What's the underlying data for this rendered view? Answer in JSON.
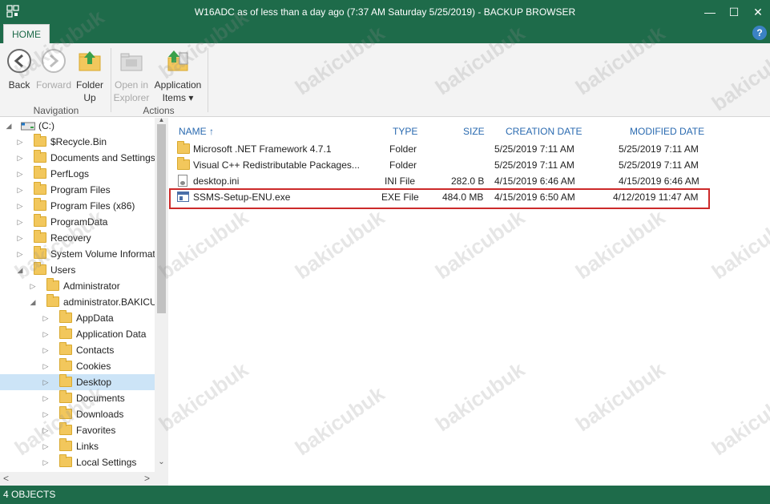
{
  "window": {
    "title": "W16ADC as of less than a day ago (7:37 AM Saturday 5/25/2019) - BACKUP BROWSER",
    "minimize_glyph": "—",
    "maximize_glyph": "☐",
    "close_glyph": "✕"
  },
  "ribbon": {
    "tab": "HOME",
    "help": "?",
    "back": "Back",
    "forward": "Forward",
    "folder_up_1": "Folder",
    "folder_up_2": "Up",
    "open_in_1": "Open in",
    "open_in_2": "Explorer",
    "app_items_1": "Application",
    "app_items_2": "Items ▾",
    "group_navigation": "Navigation",
    "group_actions": "Actions"
  },
  "tree": {
    "root": "(C:)",
    "items": [
      {
        "label": "$Recycle.Bin"
      },
      {
        "label": "Documents and Settings"
      },
      {
        "label": "PerfLogs"
      },
      {
        "label": "Program Files"
      },
      {
        "label": "Program Files (x86)"
      },
      {
        "label": "ProgramData"
      },
      {
        "label": "Recovery"
      },
      {
        "label": "System Volume Informati"
      },
      {
        "label": "Users"
      },
      {
        "label": "Administrator"
      },
      {
        "label": "administrator.BAKICU"
      },
      {
        "label": "AppData"
      },
      {
        "label": "Application Data"
      },
      {
        "label": "Contacts"
      },
      {
        "label": "Cookies"
      },
      {
        "label": "Desktop"
      },
      {
        "label": "Documents"
      },
      {
        "label": "Downloads"
      },
      {
        "label": "Favorites"
      },
      {
        "label": "Links"
      },
      {
        "label": "Local Settings"
      }
    ]
  },
  "filelist": {
    "columns": {
      "name": "NAME",
      "type": "TYPE",
      "size": "SIZE",
      "created": "CREATION DATE",
      "modified": "MODIFIED DATE"
    },
    "sort_indicator": "↑",
    "rows": [
      {
        "name": "Microsoft .NET Framework 4.7.1",
        "type": "Folder",
        "size": "",
        "created": "5/25/2019 7:11 AM",
        "modified": "5/25/2019 7:11 AM"
      },
      {
        "name": "Visual C++ Redistributable Packages...",
        "type": "Folder",
        "size": "",
        "created": "5/25/2019 7:11 AM",
        "modified": "5/25/2019 7:11 AM"
      },
      {
        "name": "desktop.ini",
        "type": "INI File",
        "size": "282.0 B",
        "created": "4/15/2019 6:46 AM",
        "modified": "4/15/2019 6:46 AM"
      },
      {
        "name": "SSMS-Setup-ENU.exe",
        "type": "EXE File",
        "size": "484.0 MB",
        "created": "4/15/2019 6:50 AM",
        "modified": "4/12/2019 11:47 AM"
      }
    ]
  },
  "status": "4 OBJECTS",
  "watermark": "bakicubuk",
  "colors": {
    "chrome": "#1e6b4a",
    "header_text": "#2a6ab0",
    "selection": "#cce4f7",
    "highlight_box": "#cc2a2a"
  }
}
